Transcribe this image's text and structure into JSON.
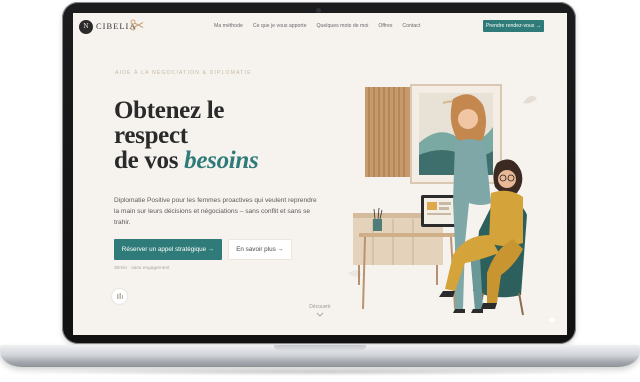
{
  "site": {
    "logo_initials": "N",
    "logo_text": "CIBELIA",
    "brand_color": "#2f7b79",
    "nav": {
      "links": [
        "Ma méthode",
        "Ce que je vous apporte",
        "Quelques mots de moi",
        "Offres",
        "Contact"
      ],
      "cta_label": "Prendre rendez-vous →"
    },
    "hero": {
      "kicker": "AIDE À LA NÉGOCIATION & DIPLOMATIE",
      "headline_line1": "Obtenez le",
      "headline_line2": "respect",
      "headline_line3_plain": "de vos",
      "headline_line3_accent": "besoins",
      "description": "Diplomatie Positive pour les femmes proactives qui veulent reprendre la main sur leurs décisions et négociations – sans conflit et sans se trahir.",
      "primary_button": "Réserver un appel stratégique  →",
      "secondary_button": "En savoir plus  →",
      "small_note": "30min · sans engagement"
    },
    "scroll_hint": "Découvrir",
    "icons": [
      "scissors-icon",
      "arrow-right-icon",
      "chevron-down-icon",
      "sparkle-icon"
    ]
  }
}
